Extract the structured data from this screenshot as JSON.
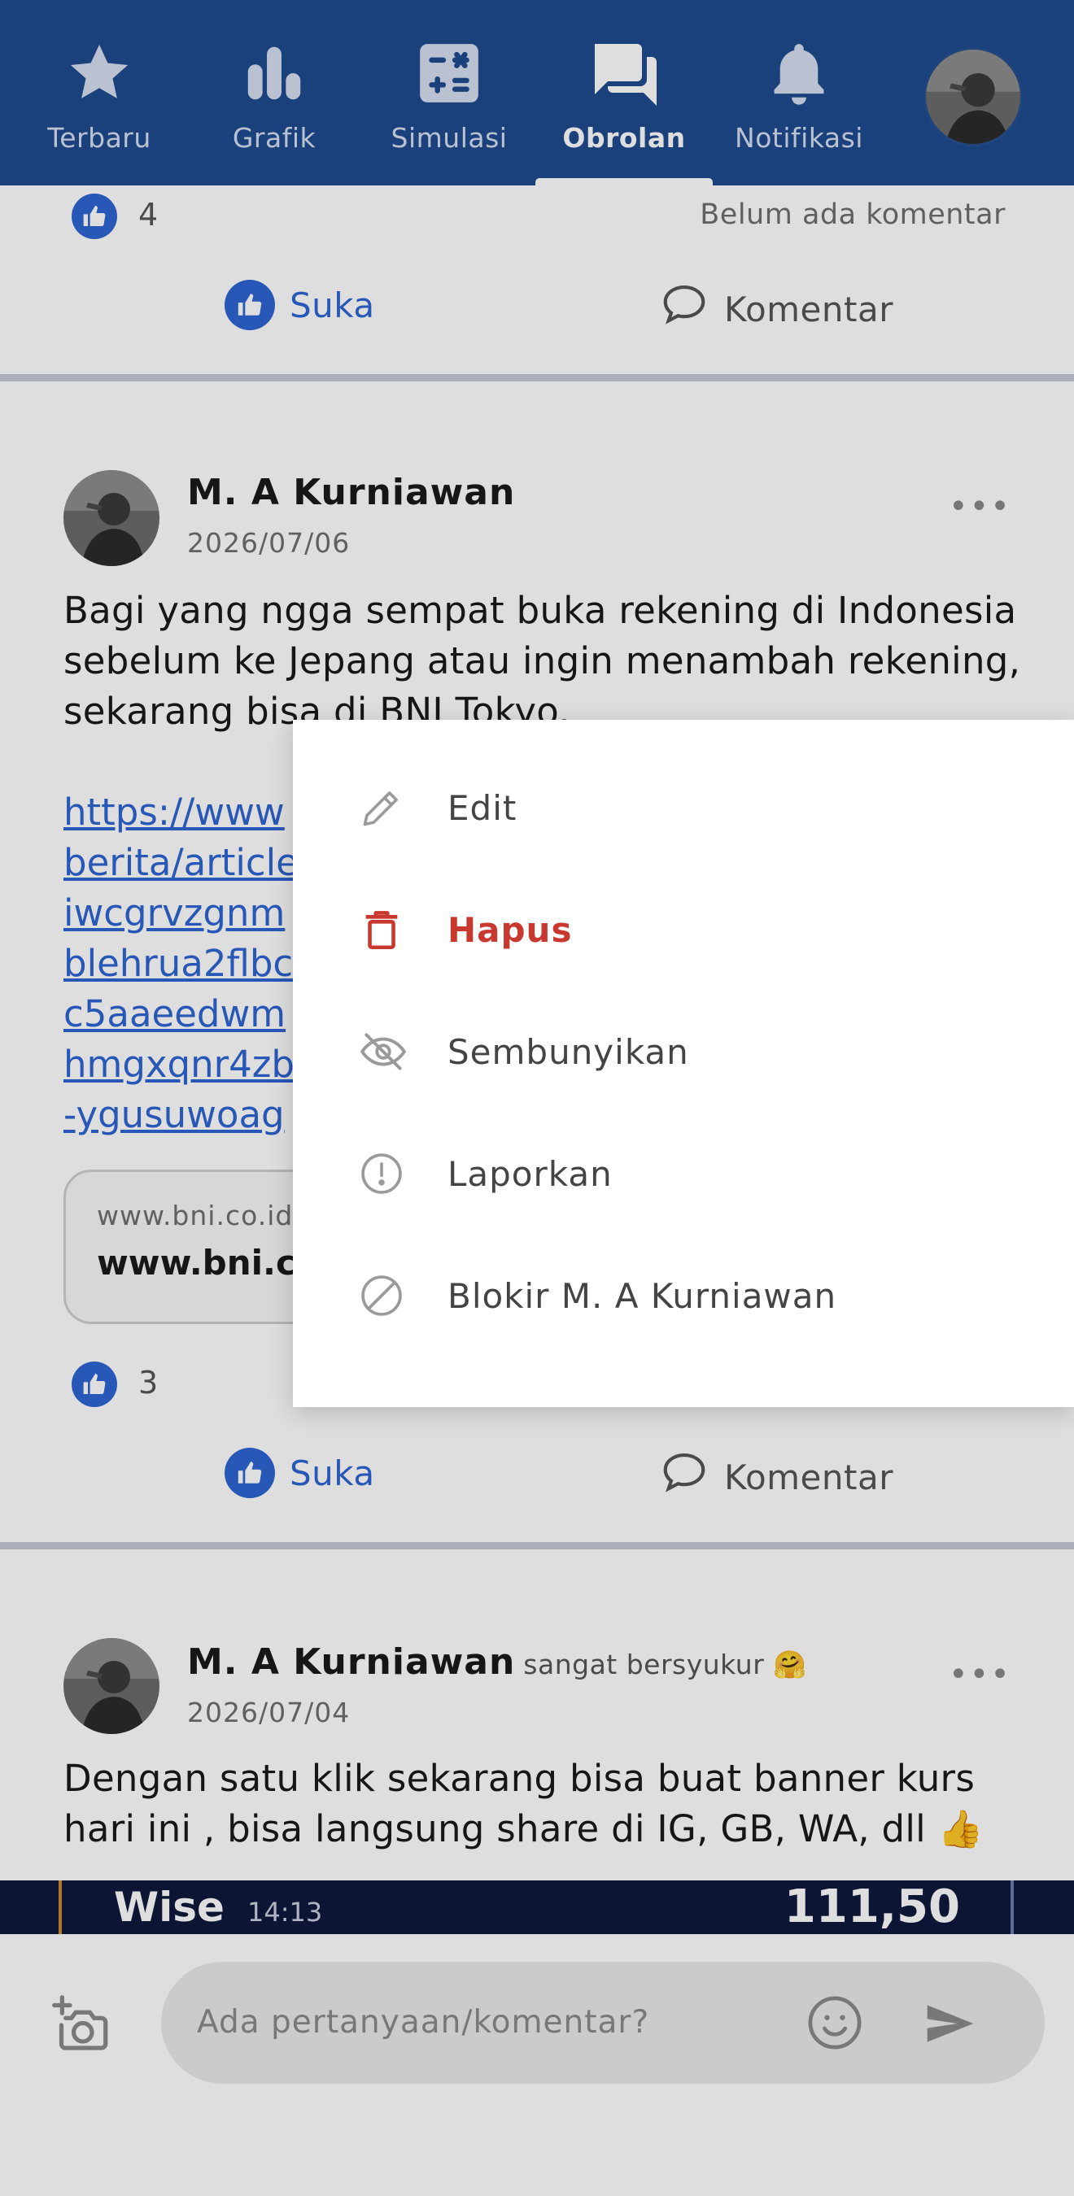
{
  "nav": {
    "items": [
      {
        "label": "Terbaru",
        "icon": "star-icon"
      },
      {
        "label": "Grafik",
        "icon": "bar-chart-icon"
      },
      {
        "label": "Simulasi",
        "icon": "calculator-icon"
      },
      {
        "label": "Obrolan",
        "icon": "chat-icon",
        "active": true
      },
      {
        "label": "Notifikasi",
        "icon": "bell-icon"
      }
    ],
    "avatar": "profile-avatar"
  },
  "post_top": {
    "like_count": "4",
    "comments_note": "Belum ada komentar",
    "like_label": "Suka",
    "comment_label": "Komentar"
  },
  "post1": {
    "author": "M. A Kurniawan",
    "date": "2026/07/06",
    "more": "•••",
    "text_lines": [
      "Bagi yang ngga sempat buka rekening di Indonesia",
      "sebelum ke Jepang atau ingin menambah rekening,",
      "sekarang bisa di BNI Tokyo."
    ],
    "link_lines": [
      "https://www",
      "berita/article",
      "iwcgrvzgnm",
      "blehrua2flbc",
      "c5aaeedwm",
      "hmgxqnr4zb",
      "-ygusuwoag"
    ],
    "preview_site": "www.bni.co.id",
    "preview_title": "www.bni.c",
    "like_count": "3",
    "like_label": "Suka",
    "comment_label": "Komentar"
  },
  "post2": {
    "author": "M. A Kurniawan",
    "feeling": "sangat bersyukur 🤗",
    "date": "2026/07/04",
    "more": "•••",
    "text_lines": [
      "Dengan satu klik sekarang bisa buat banner kurs",
      "hari ini , bisa langsung share di IG, GB, WA, dll 👍"
    ]
  },
  "wise_strip": {
    "name": "Wise",
    "time": "14:13",
    "value": "111,50"
  },
  "composer": {
    "placeholder": "Ada pertanyaan/komentar?"
  },
  "menu": {
    "items": [
      {
        "label": "Edit",
        "icon": "pencil-icon"
      },
      {
        "label": "Hapus",
        "icon": "trash-icon",
        "color": "#c8382f"
      },
      {
        "label": "Sembunyikan",
        "icon": "eye-off-icon"
      },
      {
        "label": "Laporkan",
        "icon": "alert-circle-icon"
      },
      {
        "label": "Blokir M. A Kurniawan",
        "icon": "block-icon"
      }
    ]
  },
  "colors": {
    "nav_bg": "#1e4b8f",
    "accent_blue": "#2d65d3",
    "danger_red": "#c8382f"
  }
}
